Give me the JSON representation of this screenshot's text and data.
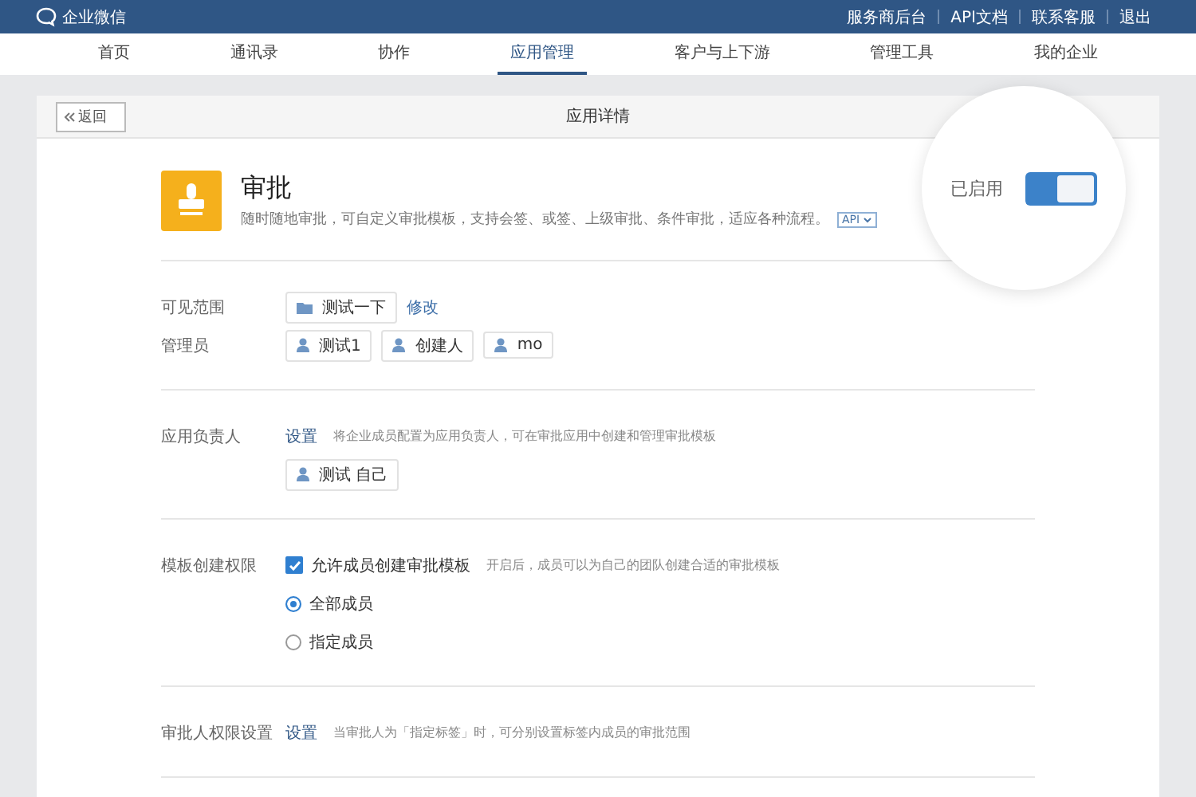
{
  "topbar": {
    "brand": "企业微信",
    "links": [
      "服务商后台",
      "API文档",
      "联系客服",
      "退出"
    ]
  },
  "nav": [
    {
      "label": "首页",
      "selected": false
    },
    {
      "label": "通讯录",
      "selected": false
    },
    {
      "label": "协作",
      "selected": false
    },
    {
      "label": "应用管理",
      "selected": true
    },
    {
      "label": "客户与上下游",
      "selected": false
    },
    {
      "label": "管理工具",
      "selected": false
    },
    {
      "label": "我的企业",
      "selected": false
    }
  ],
  "card": {
    "back": "返回",
    "title": "应用详情"
  },
  "app": {
    "name": "审批",
    "description": "随时随地审批，可自定义审批模板，支持会签、或签、上级审批、条件审批，适应各种流程。",
    "api_badge": "API"
  },
  "enable": {
    "label": "已启用",
    "on": true
  },
  "visible": {
    "label": "可见范围",
    "scope": "测试一下",
    "edit": "修改"
  },
  "admins": {
    "label": "管理员",
    "people": [
      "测试1",
      "创建人",
      "mo"
    ]
  },
  "owner": {
    "label": "应用负责人",
    "action": "设置",
    "hint": "将企业成员配置为应用负责人，可在审批应用中创建和管理审批模板",
    "people": [
      "测试 自己"
    ]
  },
  "template": {
    "label": "模板创建权限",
    "checkbox": {
      "label": "允许成员创建审批模板",
      "checked": true
    },
    "hint": "开启后，成员可以为自己的团队创建合适的审批模板",
    "options": [
      {
        "label": "全部成员",
        "selected": true
      },
      {
        "label": "指定成员",
        "selected": false
      }
    ]
  },
  "approver": {
    "label": "审批人权限设置",
    "action": "设置",
    "hint": "当审批人为「指定标签」时，可分别设置标签内成员的审批范围"
  }
}
